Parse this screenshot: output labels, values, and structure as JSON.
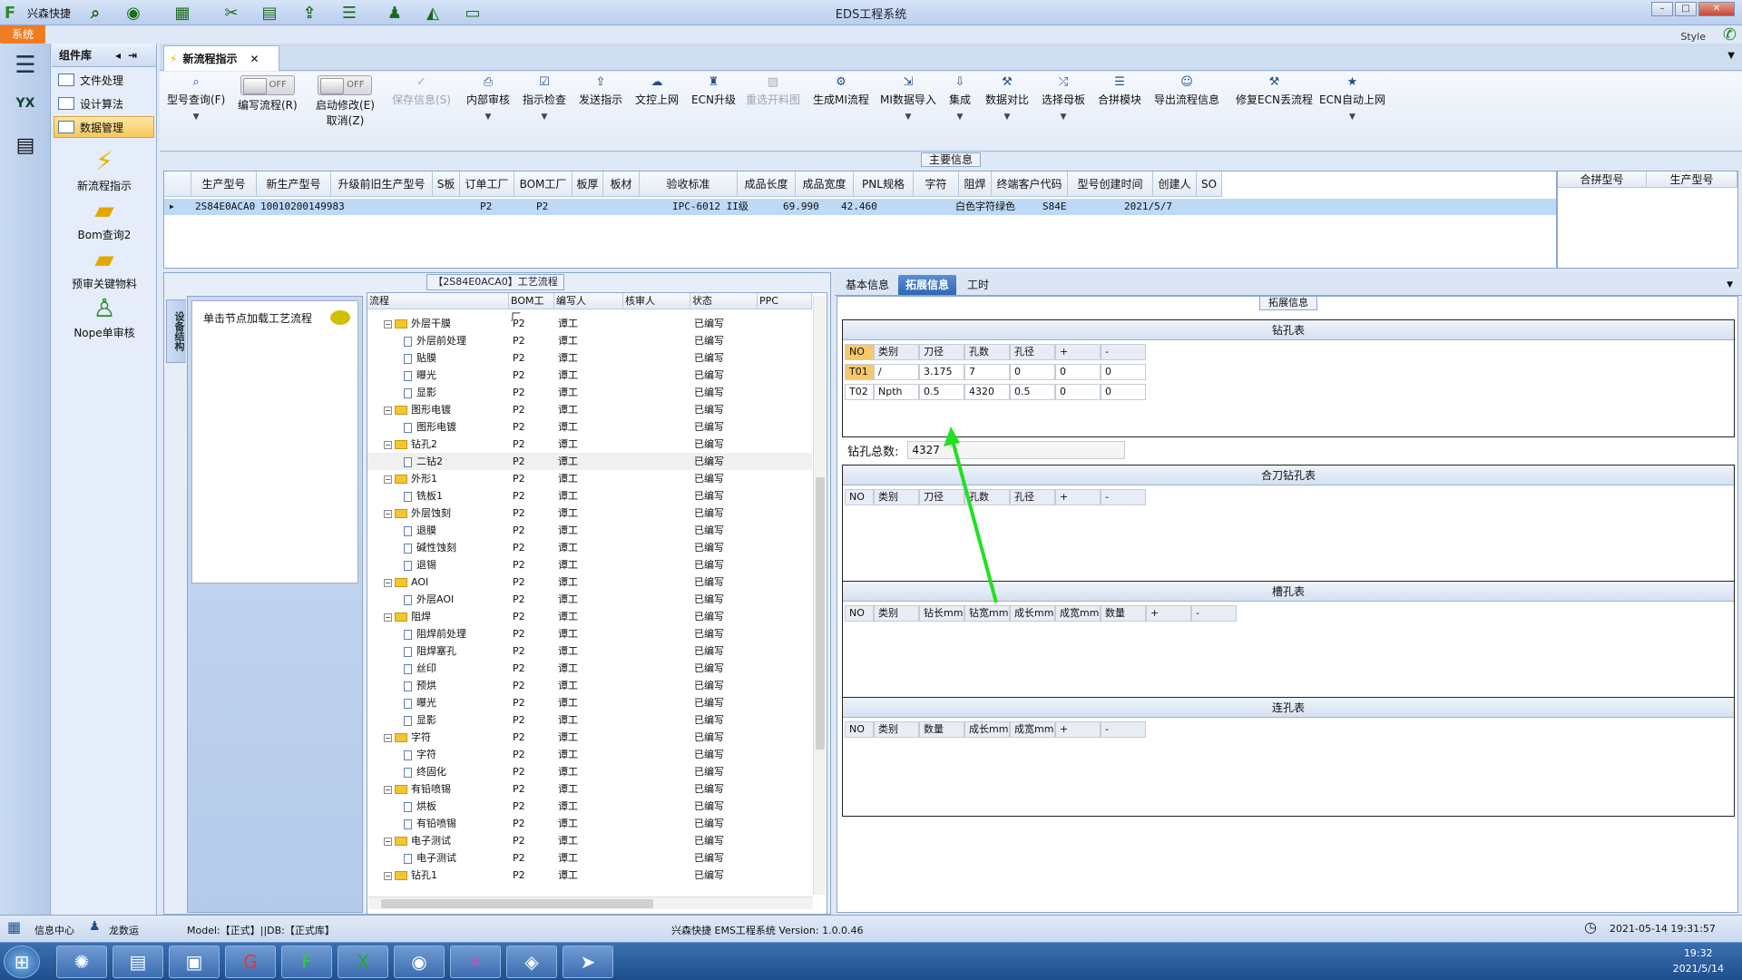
{
  "app": {
    "short_title": "兴森快捷",
    "window_title": "EDS工程系统",
    "system_tab": "系统",
    "style_label": "Style"
  },
  "library": {
    "title": "组件库",
    "items": [
      {
        "label": "文件处理"
      },
      {
        "label": "设计算法"
      },
      {
        "label": "数据管理"
      }
    ],
    "tools": [
      {
        "label": "新流程指示"
      },
      {
        "label": "Bom查询2"
      },
      {
        "label": "预审关键物料"
      },
      {
        "label": "Nope单审核"
      }
    ]
  },
  "doc_tab": {
    "label": "新流程指示"
  },
  "ribbon": {
    "buttons": [
      {
        "label": "型号查询(F)"
      },
      {
        "label": "编写流程(R)"
      },
      {
        "label": "启动修改(E)"
      },
      {
        "label": "取消(Z)"
      },
      {
        "label": "保存信息(S)"
      },
      {
        "label": "内部审核"
      },
      {
        "label": "指示检查"
      },
      {
        "label": "发送指示"
      },
      {
        "label": "文控上网"
      },
      {
        "label": "ECN升级"
      },
      {
        "label": "重选开料图"
      },
      {
        "label": "生成MI流程"
      },
      {
        "label": "MI数据导入"
      },
      {
        "label": "集成"
      },
      {
        "label": "数据对比"
      },
      {
        "label": "选择母板"
      },
      {
        "label": "合拼模块"
      },
      {
        "label": "导出流程信息"
      },
      {
        "label": "修复ECN丢流程"
      },
      {
        "label": "ECN自动上网"
      }
    ],
    "toggle_off": "OFF"
  },
  "main_info": {
    "title": "主要信息",
    "columns": [
      "生产型号",
      "新生产型号",
      "升级前旧生产型号",
      "S板",
      "订单工厂",
      "BOM工厂",
      "板厚",
      "板材",
      "验收标准",
      "成品长度",
      "成品宽度",
      "PNL规格",
      "字符",
      "阻焊",
      "终端客户代码",
      "型号创建时间",
      "创建人",
      "SO"
    ],
    "row": {
      "prod": "2S84E0ACA0",
      "new_prod": "10010200149983",
      "order_factory": "P2",
      "bom_factory": "P2",
      "standard": "IPC-6012 II级",
      "length": "69.990",
      "width": "42.460",
      "char": "白色字符",
      "mask": "绿色",
      "customer": "S84E",
      "created": "2021/5/7"
    },
    "side_columns": [
      "合拼型号",
      "生产型号"
    ]
  },
  "process": {
    "title": "【2S84E0ACA0】工艺流程",
    "side_tab": "设备结构",
    "hint": "单击节点加载工艺流程",
    "columns": [
      "流程",
      "BOM工厂",
      "编写人",
      "核审人",
      "状态",
      "PPC"
    ],
    "rows": [
      {
        "name": "外层干膜",
        "folder": true,
        "factory": "P2",
        "writer": "谭工",
        "status": "已编写"
      },
      {
        "name": "外层前处理",
        "folder": false,
        "factory": "P2",
        "writer": "谭工",
        "status": "已编写"
      },
      {
        "name": "贴膜",
        "folder": false,
        "factory": "P2",
        "writer": "谭工",
        "status": "已编写"
      },
      {
        "name": "曝光",
        "folder": false,
        "factory": "P2",
        "writer": "谭工",
        "status": "已编写"
      },
      {
        "name": "显影",
        "folder": false,
        "factory": "P2",
        "writer": "谭工",
        "status": "已编写"
      },
      {
        "name": "图形电镀",
        "folder": true,
        "factory": "P2",
        "writer": "谭工",
        "status": "已编写"
      },
      {
        "name": "图形电镀",
        "folder": false,
        "factory": "P2",
        "writer": "谭工",
        "status": "已编写"
      },
      {
        "name": "钻孔2",
        "folder": true,
        "factory": "P2",
        "writer": "谭工",
        "status": "已编写"
      },
      {
        "name": "二钻2",
        "folder": false,
        "factory": "P2",
        "writer": "谭工",
        "status": "已编写",
        "highlight": true
      },
      {
        "name": "外形1",
        "folder": true,
        "factory": "P2",
        "writer": "谭工",
        "status": "已编写"
      },
      {
        "name": "铣板1",
        "folder": false,
        "factory": "P2",
        "writer": "谭工",
        "status": "已编写"
      },
      {
        "name": "外层蚀刻",
        "folder": true,
        "factory": "P2",
        "writer": "谭工",
        "status": "已编写"
      },
      {
        "name": "退膜",
        "folder": false,
        "factory": "P2",
        "writer": "谭工",
        "status": "已编写"
      },
      {
        "name": "碱性蚀刻",
        "folder": false,
        "factory": "P2",
        "writer": "谭工",
        "status": "已编写"
      },
      {
        "name": "退锡",
        "folder": false,
        "factory": "P2",
        "writer": "谭工",
        "status": "已编写"
      },
      {
        "name": "AOI",
        "folder": true,
        "factory": "P2",
        "writer": "谭工",
        "status": "已编写"
      },
      {
        "name": "外层AOI",
        "folder": false,
        "factory": "P2",
        "writer": "谭工",
        "status": "已编写"
      },
      {
        "name": "阻焊",
        "folder": true,
        "factory": "P2",
        "writer": "谭工",
        "status": "已编写"
      },
      {
        "name": "阻焊前处理",
        "folder": false,
        "factory": "P2",
        "writer": "谭工",
        "status": "已编写"
      },
      {
        "name": "阻焊塞孔",
        "folder": false,
        "factory": "P2",
        "writer": "谭工",
        "status": "已编写"
      },
      {
        "name": "丝印",
        "folder": false,
        "factory": "P2",
        "writer": "谭工",
        "status": "已编写"
      },
      {
        "name": "预烘",
        "folder": false,
        "factory": "P2",
        "writer": "谭工",
        "status": "已编写"
      },
      {
        "name": "曝光",
        "folder": false,
        "factory": "P2",
        "writer": "谭工",
        "status": "已编写"
      },
      {
        "name": "显影",
        "folder": false,
        "factory": "P2",
        "writer": "谭工",
        "status": "已编写"
      },
      {
        "name": "字符",
        "folder": true,
        "factory": "P2",
        "writer": "谭工",
        "status": "已编写"
      },
      {
        "name": "字符",
        "folder": false,
        "factory": "P2",
        "writer": "谭工",
        "status": "已编写"
      },
      {
        "name": "终固化",
        "folder": false,
        "factory": "P2",
        "writer": "谭工",
        "status": "已编写"
      },
      {
        "name": "有铅喷锡",
        "folder": true,
        "factory": "P2",
        "writer": "谭工",
        "status": "已编写"
      },
      {
        "name": "烘板",
        "folder": false,
        "factory": "P2",
        "writer": "谭工",
        "status": "已编写"
      },
      {
        "name": "有铅喷锡",
        "folder": false,
        "factory": "P2",
        "writer": "谭工",
        "status": "已编写"
      },
      {
        "name": "电子测试",
        "folder": true,
        "factory": "P2",
        "writer": "谭工",
        "status": "已编写"
      },
      {
        "name": "电子测试",
        "folder": false,
        "factory": "P2",
        "writer": "谭工",
        "status": "已编写"
      },
      {
        "name": "钻孔1",
        "folder": true,
        "factory": "P2",
        "writer": "谭工",
        "status": "已编写"
      }
    ]
  },
  "right_tabs": [
    {
      "label": "基本信息"
    },
    {
      "label": "拓展信息"
    },
    {
      "label": "工时"
    }
  ],
  "ext": {
    "title": "拓展信息",
    "drill": {
      "title": "钻孔表",
      "headers": [
        "NO",
        "类别",
        "刀径",
        "孔数",
        "孔径",
        "+",
        "-"
      ],
      "rows": [
        [
          "T01",
          "/",
          "3.175",
          "7",
          "0",
          "0",
          "0"
        ],
        [
          "T02",
          "Npth",
          "0.5",
          "4320",
          "0.5",
          "0",
          "0"
        ]
      ]
    },
    "drill_total_label": "钻孔总数:",
    "drill_total": "4327",
    "combo": {
      "title": "合刀钻孔表",
      "headers": [
        "NO",
        "类别",
        "刀径",
        "孔数",
        "孔径",
        "+",
        "-"
      ]
    },
    "slot": {
      "title": "槽孔表",
      "headers": [
        "NO",
        "类别",
        "钻长mm",
        "钻宽mm",
        "成长mm",
        "成宽mm",
        "数量",
        "+",
        "-"
      ]
    },
    "link": {
      "title": "连孔表",
      "headers": [
        "NO",
        "类别",
        "数量",
        "成长mm",
        "成宽mm",
        "+",
        "-"
      ]
    }
  },
  "status": {
    "info_center": "信息中心",
    "user": "龙数运",
    "model_db": "Model:【正式】||DB:【正式库】",
    "version": "兴森快捷 EMS工程系统 Version: 1.0.0.46",
    "datetime": "2021-05-14 19:31:57"
  },
  "taskbar": {
    "time": "19:32",
    "date": "2021/5/14"
  }
}
